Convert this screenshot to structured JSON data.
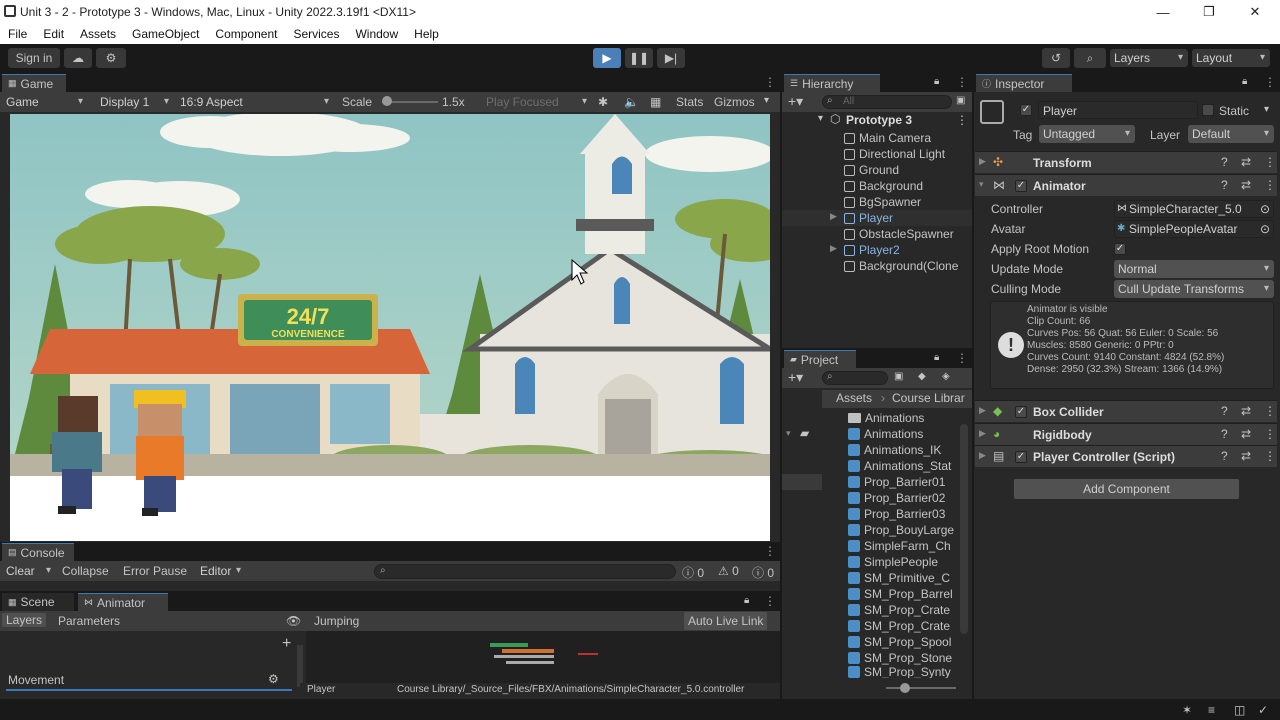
{
  "window": {
    "title": "Unit 3 - 2 - Prototype 3 - Windows, Mac, Linux - Unity 2022.3.19f1 <DX11>"
  },
  "menu": [
    "File",
    "Edit",
    "Assets",
    "GameObject",
    "Component",
    "Services",
    "Window",
    "Help"
  ],
  "toolbar": {
    "sign_in": "Sign in",
    "layers": "Layers",
    "layout": "Layout"
  },
  "game": {
    "tab": "Game",
    "mode": "Game",
    "display": "Display 1",
    "aspect": "16:9 Aspect",
    "scale_label": "Scale",
    "scale_value": "1.5x",
    "play_focused": "Play Focused",
    "stats": "Stats",
    "gizmos": "Gizmos",
    "sign_text": "24/7",
    "sign_sub": "CONVENIENCE"
  },
  "console": {
    "tab": "Console",
    "clear": "Clear",
    "collapse": "Collapse",
    "error_pause": "Error Pause",
    "editor": "Editor",
    "count_log": "0",
    "count_warn": "0",
    "count_err": "0"
  },
  "animator": {
    "tab_scene": "Scene",
    "tab_animator": "Animator",
    "layers": "Layers",
    "parameters": "Parameters",
    "breadcrumb": "Jumping",
    "auto_live_link": "Auto Live Link",
    "layer_name": "Movement",
    "status_object": "Player",
    "status_path": "Course Library/_Source_Files/FBX/Animations/SimpleCharacter_5.0.controller"
  },
  "hierarchy": {
    "tab": "Hierarchy",
    "search_placeholder": "All",
    "scene": "Prototype 3",
    "items": [
      "Main Camera",
      "Directional Light",
      "Ground",
      "Background",
      "BgSpawner",
      "Player",
      "ObstacleSpawner",
      "Player2",
      "Background(Clone"
    ]
  },
  "project": {
    "tab": "Project",
    "breadcrumb_root": "Assets",
    "breadcrumb_sub": "Course Librar",
    "items": [
      "Animations",
      "Animations",
      "Animations_IK",
      "Animations_Stat",
      "Prop_Barrier01",
      "Prop_Barrier02",
      "Prop_Barrier03",
      "Prop_BouyLarge",
      "SimpleFarm_Ch",
      "SimplePeople",
      "SM_Primitive_C",
      "SM_Prop_Barrel",
      "SM_Prop_Crate",
      "SM_Prop_Crate",
      "SM_Prop_Spool",
      "SM_Prop_Stone",
      "SM_Prop_Synty"
    ]
  },
  "inspector": {
    "tab": "Inspector",
    "object_name": "Player",
    "static": "Static",
    "tag_label": "Tag",
    "tag_value": "Untagged",
    "layer_label": "Layer",
    "layer_value": "Default",
    "transform": "Transform",
    "animator": "Animator",
    "controller_label": "Controller",
    "controller_value": "SimpleCharacter_5.0",
    "avatar_label": "Avatar",
    "avatar_value": "SimplePeopleAvatar",
    "apply_root_motion": "Apply Root Motion",
    "update_mode_label": "Update Mode",
    "update_mode_value": "Normal",
    "culling_mode_label": "Culling Mode",
    "culling_mode_value": "Cull Update Transforms",
    "info_lines": [
      "Animator is visible",
      "Clip Count: 66",
      "Curves Pos: 56 Quat: 56 Euler: 0 Scale: 56",
      "Muscles: 8580 Generic: 0 PPtr: 0",
      "Curves Count: 9140 Constant: 4824 (52.8%)",
      "Dense: 2950 (32.3%) Stream: 1366 (14.9%)"
    ],
    "box_collider": "Box Collider",
    "rigidbody": "Rigidbody",
    "player_controller": "Player Controller (Script)",
    "add_component": "Add Component"
  }
}
